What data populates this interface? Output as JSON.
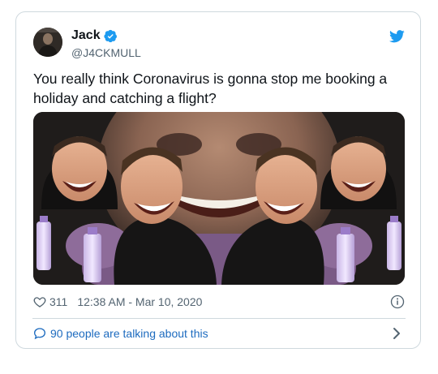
{
  "tweet": {
    "author_name": "Jack",
    "author_handle": "@J4CKMULL",
    "text": "You really think Coronavirus is gonna stop me booking a holiday and catching a flight?",
    "like_count": "311",
    "timestamp": "12:38 AM - Mar 10, 2020",
    "conversation_text": "90 people are talking about this"
  },
  "icons": {
    "verified": "verified-badge-icon",
    "brand": "twitter-bird-icon",
    "like": "heart-icon",
    "info": "info-icon",
    "reply": "speech-bubble-icon",
    "chevron": "chevron-right-icon"
  },
  "colors": {
    "accent": "#1d9bf0",
    "link": "#1d6bbf",
    "text": "#0f1419",
    "muted": "#536471",
    "border": "#cfd9de"
  }
}
